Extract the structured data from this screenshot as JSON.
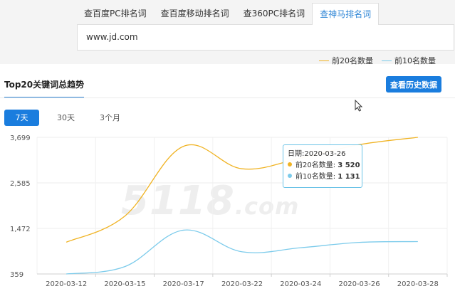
{
  "tabs": [
    {
      "label": "查百度PC排名词",
      "active": false
    },
    {
      "label": "查百度移动排名词",
      "active": false
    },
    {
      "label": "查360PC排名词",
      "active": false
    },
    {
      "label": "查神马排名词",
      "active": true
    }
  ],
  "search": {
    "value": "www.jd.com"
  },
  "panel": {
    "title": "Top20关键词总趋势",
    "history_button": "查看历史数据",
    "ranges": [
      "7天",
      "30天",
      "3个月"
    ],
    "active_range": "7天"
  },
  "colors": {
    "accent": "#1a7dde",
    "top20": "#f0b323",
    "top10": "#7ccbeb"
  },
  "watermark": {
    "main": "5118",
    "suffix": ".com"
  },
  "tooltip": {
    "date_label": "日期:",
    "date": "2020-03-26",
    "top20_label": "前20名数量:",
    "top20_value": "3 520",
    "top10_label": "前10名数量:",
    "top10_value": "1 131"
  },
  "chart_data": {
    "type": "line",
    "categories": [
      "2020-03-12",
      "2020-03-15",
      "2020-03-17",
      "2020-03-22",
      "2020-03-24",
      "2020-03-26",
      "2020-03-28"
    ],
    "y_ticks": [
      "3,699",
      "2,585",
      "1,472",
      "359"
    ],
    "ylim": [
      359,
      3699
    ],
    "grid": true,
    "legend_position": "top-right",
    "series": [
      {
        "name": "前20名数量",
        "values": [
          1135,
          1775,
          3480,
          2930,
          3190,
          3520,
          3699
        ]
      },
      {
        "name": "前10名数量",
        "values": [
          359,
          540,
          1430,
          900,
          1000,
          1131,
          1150
        ]
      }
    ]
  }
}
